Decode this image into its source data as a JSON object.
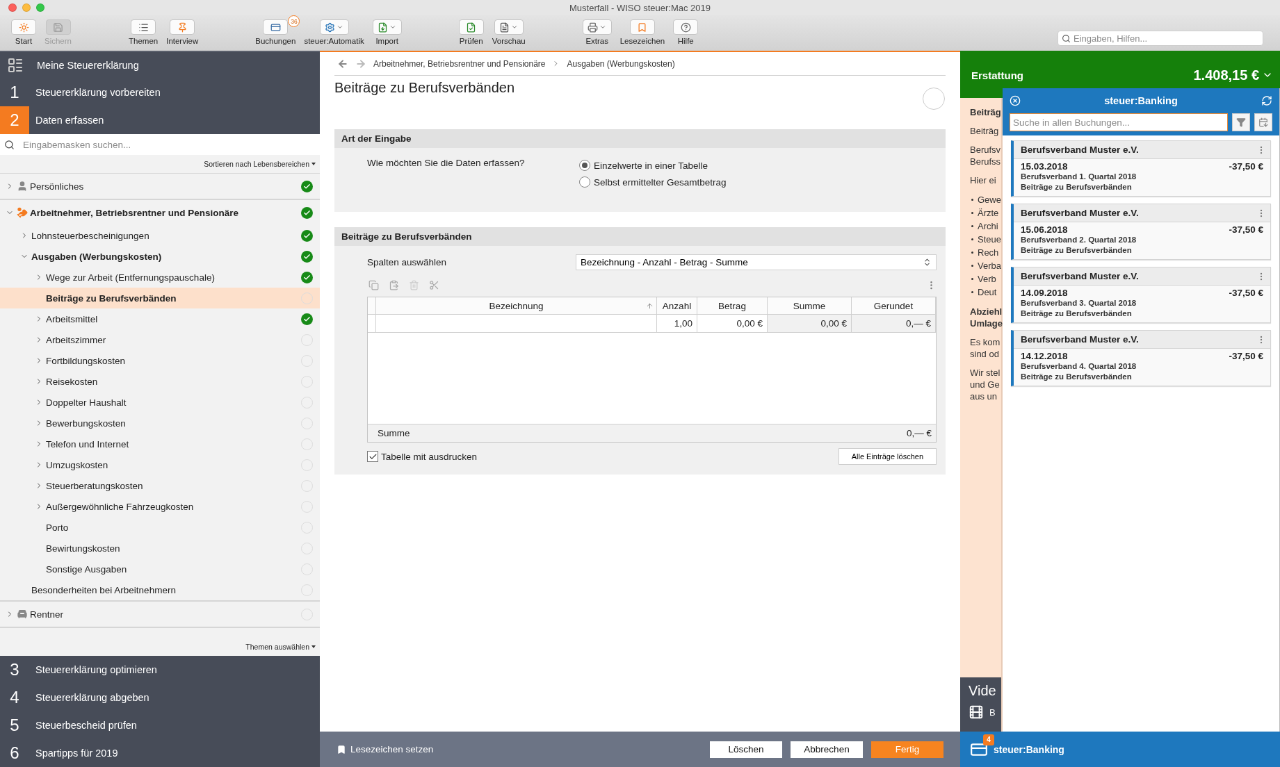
{
  "window": {
    "title": "Musterfall - WISO steuer:Mac 2019"
  },
  "toolbar": {
    "groups": [
      [
        {
          "label": "Start",
          "disabled": false,
          "menu": false
        },
        {
          "label": "Sichern",
          "disabled": true,
          "menu": false
        }
      ],
      [
        {
          "label": "Themen",
          "disabled": false,
          "menu": false
        },
        {
          "label": "Interview",
          "disabled": false,
          "menu": false
        }
      ],
      [
        {
          "label": "Buchungen",
          "disabled": false,
          "menu": false,
          "badge": "36"
        },
        {
          "label": "steuer:Automatik",
          "disabled": false,
          "menu": true
        },
        {
          "label": "Import",
          "disabled": false,
          "menu": true
        }
      ],
      [
        {
          "label": "Prüfen",
          "disabled": false,
          "menu": false
        },
        {
          "label": "Vorschau",
          "disabled": false,
          "menu": true
        }
      ],
      [
        {
          "label": "Extras",
          "disabled": false,
          "menu": true
        },
        {
          "label": "Lesezeichen",
          "disabled": false,
          "menu": false
        },
        {
          "label": "Hilfe",
          "disabled": false,
          "menu": false
        }
      ]
    ],
    "search": {
      "placeholder": "Eingaben, Hilfen..."
    }
  },
  "sidebar": {
    "header": "Meine Steuererklärung",
    "steps": [
      {
        "number": "1",
        "label": "Steuererklärung vorbereiten",
        "selected": false
      },
      {
        "number": "2",
        "label": "Daten erfassen",
        "selected": true
      },
      {
        "number": "3",
        "label": "Steuererklärung optimieren",
        "selected": false
      },
      {
        "number": "4",
        "label": "Steuererklärung abgeben",
        "selected": false
      },
      {
        "number": "5",
        "label": "Steuerbescheid prüfen",
        "selected": false
      },
      {
        "number": "6",
        "label": "Spartipps für 2019",
        "selected": false
      }
    ],
    "search": {
      "placeholder": "Eingabemasken suchen..."
    },
    "sort_menu": "Sortieren nach Lebensbereichen",
    "tree": [
      {
        "label": "Persönliches",
        "expanded": false,
        "done": true,
        "selected": false
      },
      {
        "label": "Arbeitnehmer, Betriebsrentner und Pensionäre",
        "expanded": true,
        "done": true,
        "selected": false,
        "children": [
          {
            "label": "Lohnsteuerbescheinigungen",
            "expanded": false,
            "done": true,
            "selected": false
          },
          {
            "label": "Ausgaben (Werbungskosten)",
            "expanded": true,
            "done": true,
            "selected": false,
            "children": [
              {
                "label": "Wege zur Arbeit (Entfernungspauschale)",
                "expanded": false,
                "done": true,
                "selected": false
              },
              {
                "label": "Beiträge zu Berufsverbänden",
                "done": false,
                "selected": true
              },
              {
                "label": "Arbeitsmittel",
                "expanded": false,
                "done": true,
                "selected": false
              },
              {
                "label": "Arbeitszimmer",
                "expanded": false,
                "done": false,
                "selected": false
              },
              {
                "label": "Fortbildungskosten",
                "expanded": false,
                "done": false,
                "selected": false
              },
              {
                "label": "Reisekosten",
                "expanded": false,
                "done": false,
                "selected": false
              },
              {
                "label": "Doppelter Haushalt",
                "expanded": false,
                "done": false,
                "selected": false
              },
              {
                "label": "Bewerbungskosten",
                "expanded": false,
                "done": false,
                "selected": false
              },
              {
                "label": "Telefon und Internet",
                "expanded": false,
                "done": false,
                "selected": false
              },
              {
                "label": "Umzugskosten",
                "expanded": false,
                "done": false,
                "selected": false
              },
              {
                "label": "Steuerberatungskosten",
                "expanded": false,
                "done": false,
                "selected": false
              },
              {
                "label": "Außergewöhnliche Fahrzeugkosten",
                "expanded": false,
                "done": false,
                "selected": false
              },
              {
                "label": "Porto",
                "done": false,
                "selected": false
              },
              {
                "label": "Bewirtungskosten",
                "done": false,
                "selected": false
              },
              {
                "label": "Sonstige Ausgaben",
                "done": false,
                "selected": false
              }
            ]
          },
          {
            "label": "Besonderheiten bei Arbeitnehmern",
            "done": false,
            "selected": false
          }
        ]
      },
      {
        "label": "Rentner",
        "expanded": false,
        "done": false,
        "selected": false
      }
    ],
    "topics_menu": "Themen auswählen"
  },
  "content": {
    "breadcrumb": [
      "Arbeitnehmer, Betriebsrentner und Pensionäre",
      "Ausgaben (Werbungskosten)"
    ],
    "title": "Beiträge zu Berufsverbänden",
    "input_mode": {
      "title": "Art der Eingabe",
      "question": "Wie möchten Sie die Daten erfassen?",
      "options": [
        {
          "label": "Einzelwerte in einer Tabelle",
          "selected": true
        },
        {
          "label": "Selbst ermittelter Gesamtbetrag",
          "selected": false
        }
      ]
    },
    "entries": {
      "title": "Beiträge zu Berufsverbänden",
      "columns_label": "Spalten auswählen",
      "columns_value": "Bezeichnung - Anzahl - Betrag - Summe",
      "table": {
        "columns": [
          {
            "label": "Bezeichnung",
            "sorted": true
          },
          {
            "label": "Anzahl",
            "sorted": false
          },
          {
            "label": "Betrag",
            "sorted": false
          },
          {
            "label": "Summe",
            "sorted": false
          },
          {
            "label": "Gerundet",
            "sorted": false
          }
        ],
        "rows": [
          {
            "anzahl": "1,00",
            "betrag": "0,00 €",
            "summe": "0,00 €",
            "gerundet": "0,— €"
          }
        ],
        "total": {
          "label": "Summe",
          "value": "0,— €"
        }
      },
      "print_table": {
        "label": "Tabelle mit ausdrucken",
        "checked": true
      },
      "clear_button": "Alle Einträge löschen"
    },
    "footer": {
      "bookmark": "Lesezeichen setzen",
      "buttons": [
        {
          "label": "Löschen",
          "primary": false
        },
        {
          "label": "Abbrechen",
          "primary": false
        },
        {
          "label": "Fertig",
          "primary": true
        }
      ]
    }
  },
  "refund": {
    "label": "Erstattung",
    "amount": "1.408,15 €"
  },
  "help_text": [
    {
      "kind": "heading",
      "lines": [
        "Beiträg"
      ]
    },
    {
      "kind": "text",
      "lines": [
        "Beiträg"
      ]
    },
    {
      "kind": "text",
      "lines": [
        "Berufsv",
        "Berufss"
      ]
    },
    {
      "kind": "text",
      "lines": [
        "Hier ei"
      ]
    },
    {
      "kind": "bullets",
      "lines": [
        "Gewe",
        "Ärzte",
        "Archi",
        "Steue",
        "Rech",
        "Verba",
        "Verb",
        "Deut"
      ]
    },
    {
      "kind": "heading",
      "lines": [
        "Abziehl",
        "Umlage"
      ]
    },
    {
      "kind": "text",
      "lines": [
        "Es kom",
        "sind od"
      ]
    },
    {
      "kind": "text",
      "lines": [
        "Wir stel",
        "und Ge",
        "aus un"
      ]
    }
  ],
  "videos": {
    "title": "Vide",
    "items": [
      "B"
    ]
  },
  "banking": {
    "title": "steuer:Banking",
    "search": {
      "placeholder": "Suche in allen Buchungen..."
    },
    "bookings": [
      {
        "payee": "Berufsverband Muster e.V.",
        "date": "15.03.2018",
        "amount": "-37,50 €",
        "purpose": "Berufsverband 1. Quartal 2018",
        "category": "Beiträge zu Berufsverbänden"
      },
      {
        "payee": "Berufsverband Muster e.V.",
        "date": "15.06.2018",
        "amount": "-37,50 €",
        "purpose": "Berufsverband 2. Quartal 2018",
        "category": "Beiträge zu Berufsverbänden"
      },
      {
        "payee": "Berufsverband Muster e.V.",
        "date": "14.09.2018",
        "amount": "-37,50 €",
        "purpose": "Berufsverband 3. Quartal 2018",
        "category": "Beiträge zu Berufsverbänden"
      },
      {
        "payee": "Berufsverband Muster e.V.",
        "date": "14.12.2018",
        "amount": "-37,50 €",
        "purpose": "Berufsverband 4. Quartal 2018",
        "category": "Beiträge zu Berufsverbänden"
      }
    ]
  },
  "banking_bar": {
    "label": "steuer:Banking",
    "badge": "4"
  }
}
